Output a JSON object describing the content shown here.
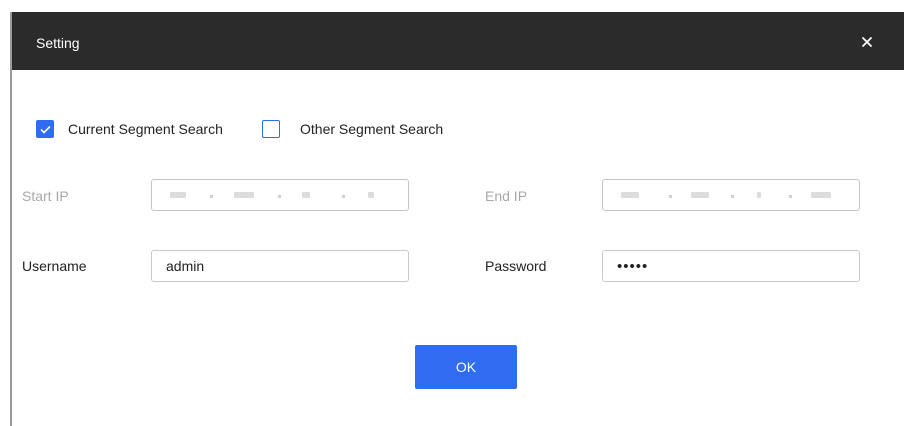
{
  "dialog": {
    "title": "Setting",
    "close_icon": "close-icon"
  },
  "search_mode": {
    "current_segment": {
      "label": "Current Segment Search",
      "checked": true
    },
    "other_segment": {
      "label": "Other Segment Search",
      "checked": false
    }
  },
  "fields": {
    "start_ip": {
      "label": "Start IP",
      "disabled": true
    },
    "end_ip": {
      "label": "End IP",
      "disabled": true
    },
    "username": {
      "label": "Username",
      "value": "admin"
    },
    "password": {
      "label": "Password",
      "value": "•••••"
    }
  },
  "actions": {
    "ok_label": "OK"
  },
  "colors": {
    "accent": "#2f6cf2",
    "titlebar": "#2b2b2b"
  }
}
